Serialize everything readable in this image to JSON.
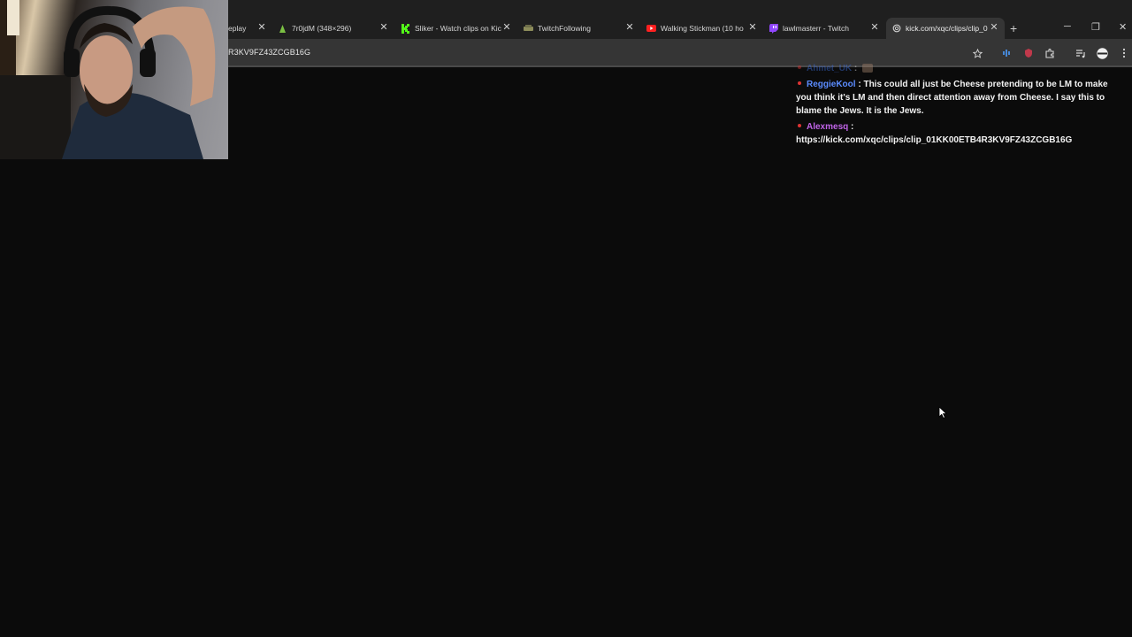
{
  "browser": {
    "tabs": [
      {
        "title": "eplay",
        "favicon": "page-icon",
        "active": false
      },
      {
        "title": "7r0jdM (348×296)",
        "favicon": "image-icon",
        "active": false
      },
      {
        "title": "Sliker - Watch clips on Kic",
        "favicon": "kick-icon",
        "active": false
      },
      {
        "title": "TwitchFollowing",
        "favicon": "twitch-following-icon",
        "active": false
      },
      {
        "title": "Walking Stickman (10 ho",
        "favicon": "youtube-icon",
        "active": false
      },
      {
        "title": "lawlmasterr - Twitch",
        "favicon": "twitch-icon",
        "active": false
      },
      {
        "title": "kick.com/xqc/clips/clip_0",
        "favicon": "loading-icon",
        "active": true
      }
    ],
    "close_glyph": "✕",
    "new_tab_glyph": "+",
    "window_controls": {
      "minimize": "─",
      "restore": "❐",
      "close": "✕"
    },
    "address_text": "R3KV9FZ43ZCGB16G",
    "accent_color": "#3d6fe0"
  },
  "chat": {
    "messages": [
      {
        "user": "Ahmet_UK",
        "separator": ":",
        "text": "",
        "faded": true,
        "has_emote": true
      },
      {
        "user": "ReggieKool",
        "separator": ":",
        "text": "This could all just be Cheese pretending to be LM to make you think it's LM and then direct attention away from Cheese. I say this to blame the Jews. It is the Jews.",
        "faded": false,
        "has_emote": false
      },
      {
        "user": "Alexmesq",
        "separator": ":",
        "text": "https://kick.com/xqc/clips/clip_01KK00ETB4R3KV9FZ43ZCGB16G",
        "faded": false,
        "has_emote": false
      }
    ],
    "badge_color": "#dd3333"
  }
}
